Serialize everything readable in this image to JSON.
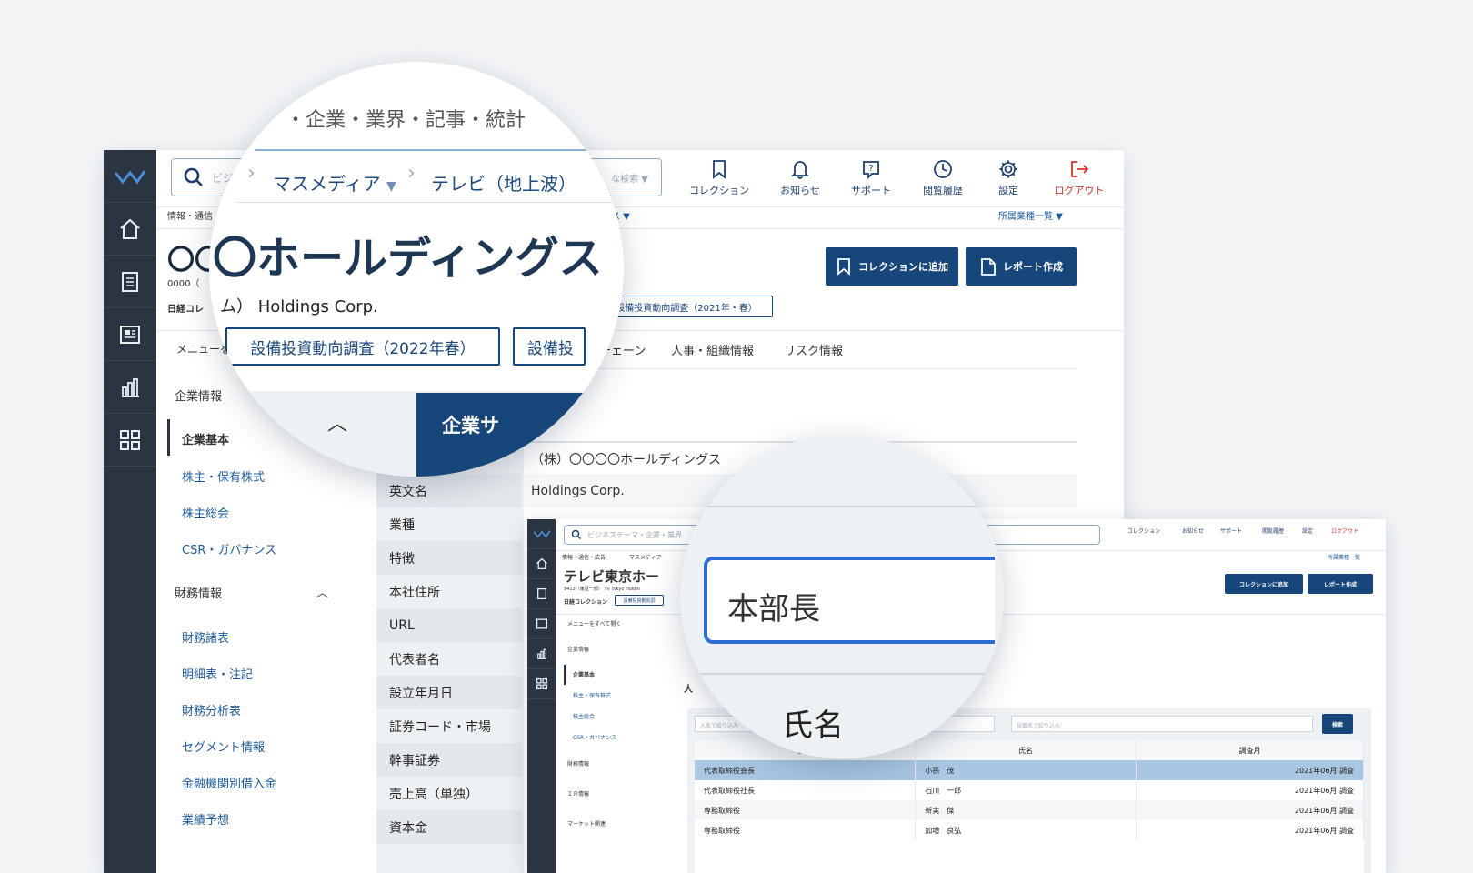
{
  "brand_color": "#17467a",
  "accent_red": "#d6332b",
  "main": {
    "search_placeholder": "ビジ",
    "search_mode": "な検索",
    "toolbar": [
      {
        "label": "コレクション",
        "icon": "bookmark-icon"
      },
      {
        "label": "お知らせ",
        "icon": "bell-icon"
      },
      {
        "label": "サポート",
        "icon": "help-icon"
      },
      {
        "label": "閲覧履歴",
        "icon": "clock-icon"
      },
      {
        "label": "設定",
        "icon": "gear-icon"
      },
      {
        "label": "ログアウト",
        "icon": "logout-icon"
      }
    ],
    "breadcrumb_left": "情報・通信",
    "breadcrumb_right": "グス",
    "industry_list": "所属業種一覧",
    "company_title": "〇〇",
    "company_code": "0000（",
    "collection_label": "日経コレ",
    "add_collection": "コレクションに追加",
    "create_report": "レポート作成",
    "survey_tag": "設備投資動向調査（2021年・春）",
    "menu_open": "メニューを",
    "tabs": [
      "イチェーン",
      "人事・組織情報",
      "リスク情報"
    ],
    "side_section_1": "企業情報",
    "side_active": "企業基本",
    "side_items_1": [
      "株主・保有株式",
      "株主総会",
      "CSR・ガバナンス"
    ],
    "side_section_2": "財務情報",
    "side_items_2": [
      "財務諸表",
      "明細表・注記",
      "財務分析表",
      "セグメント情報",
      "金融機関別借入金",
      "業績予想"
    ],
    "table_labels": [
      "英文名",
      "業種",
      "特徴",
      "本社住所",
      "URL",
      "代表者名",
      "設立年月日",
      "証券コード・市場",
      "幹事証券",
      "売上高（単独）",
      "資本金"
    ],
    "table_values": [
      "（株）〇〇〇〇ホールディングス",
      "Holdings Corp."
    ]
  },
  "magnifier1": {
    "search_scope": "・企業・業界・記事・統計",
    "crumb1": "マスメディア",
    "crumb2": "テレビ（地上波）",
    "company_name": "〇ホールディングス",
    "company_en": "ム） Holdings Corp.",
    "tag1": "設備投資動向調査（2022年春）",
    "tag2": "設備投",
    "summary_btn": "企業サ"
  },
  "magnifier2": {
    "field_value": "本部長",
    "column": "氏名"
  },
  "second": {
    "search_placeholder": "ビジネステーマ・企業・業界",
    "breadcrumb_left": "情報・通信・広告",
    "breadcrumb_mid": "マスメディア",
    "industry_list": "所属業種一覧",
    "company_title": "テレビ東京ホー",
    "company_code": "9413（東証一部） TV Tokyo Holdin",
    "collection_label": "日経コレクション",
    "survey_tag": "設備投資動向調",
    "add_collection": "コレクションに追加",
    "create_report": "レポート作成",
    "menu_open": "メニューをすべて開く",
    "side_section_1": "企業情報",
    "side_active": "企業基本",
    "side_items": [
      "株主・保有株式",
      "株主総会",
      "CSR・ガバナンス"
    ],
    "side_sections": [
      "財務情報",
      "ＩＲ情報",
      "マーケット関連"
    ],
    "section_heading": "人",
    "filter_person": "人名で絞り込み",
    "filter_role": "役職名で絞り込み",
    "search_btn": "検索",
    "columns": [
      "役職",
      "氏名",
      "調査月"
    ],
    "rows": [
      {
        "role": "代表取締役会長",
        "name": "小孫　茂",
        "month": "2021年06月 調査"
      },
      {
        "role": "代表取締役社長",
        "name": "石川　一郎",
        "month": "2021年06月 調査"
      },
      {
        "role": "専務取締役",
        "name": "新実　傑",
        "month": "2021年06月 調査"
      },
      {
        "role": "専務取締役",
        "name": "加増　良弘",
        "month": "2021年06月 調査"
      }
    ]
  }
}
